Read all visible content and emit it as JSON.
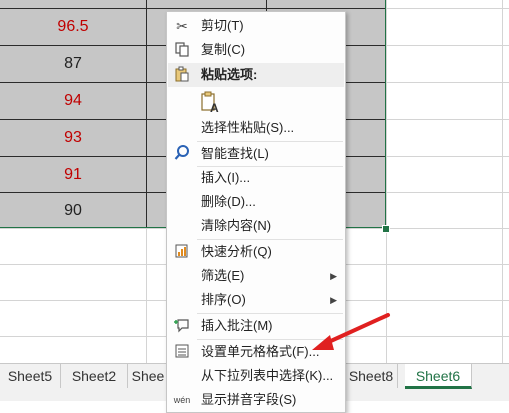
{
  "cells": [
    {
      "value": "96.5",
      "color": "#c00000"
    },
    {
      "value": "87",
      "color": "#222222"
    },
    {
      "value": "94",
      "color": "#c00000"
    },
    {
      "value": "93",
      "color": "#c00000"
    },
    {
      "value": "91",
      "color": "#c00000"
    },
    {
      "value": "90",
      "color": "#222222"
    }
  ],
  "context_menu": {
    "cut": "剪切(T)",
    "copy": "复制(C)",
    "paste_options": "粘贴选项:",
    "paste_special": "选择性粘贴(S)...",
    "smart_lookup": "智能查找(L)",
    "insert": "插入(I)...",
    "delete": "删除(D)...",
    "clear_contents": "清除内容(N)",
    "quick_analysis": "快速分析(Q)",
    "filter": "筛选(E)",
    "sort": "排序(O)",
    "insert_comment": "插入批注(M)",
    "format_cells": "设置单元格格式(F)...",
    "pick_from_list": "从下拉列表中选择(K)...",
    "phonetic": "显示拼音字段(S)"
  },
  "sheet_tabs": [
    "Sheet5",
    "Sheet2",
    "Shee",
    "Sheet8",
    "Sheet6"
  ],
  "active_tab": "Sheet6",
  "colors": {
    "accent": "#217346",
    "selection": "#c6c6c6",
    "arrow": "#e02020"
  }
}
